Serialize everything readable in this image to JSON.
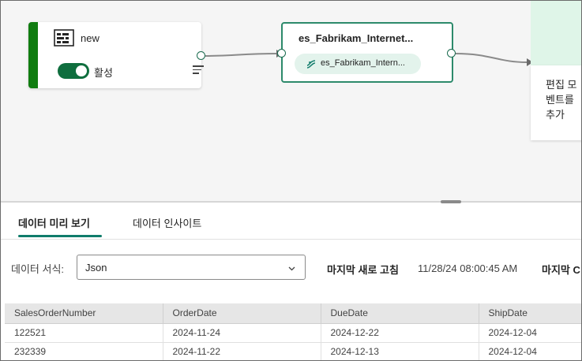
{
  "source_node": {
    "name": "new",
    "toggle_label": "활성",
    "toggle_on": true
  },
  "stream_node": {
    "title": "es_Fabrikam_Internet...",
    "pill_text": "es_Fabrikam_Intern..."
  },
  "destination_node": {
    "text": "편집 모\n벤트를\n추가"
  },
  "tabs": [
    {
      "label": "데이터 미리 보기",
      "active": true
    },
    {
      "label": "데이터 인사이트",
      "active": false
    }
  ],
  "toolbar": {
    "format_label": "데이터 서식:",
    "format_value": "Json",
    "last_refresh_label": "마지막 새로 고침",
    "last_refresh_value": "11/28/24 08:00:45 AM",
    "last_label_cut": "마지막 C"
  },
  "table": {
    "columns": [
      "SalesOrderNumber",
      "OrderDate",
      "DueDate",
      "ShipDate"
    ],
    "rows": [
      [
        "122521",
        "2024-11-24",
        "2024-12-22",
        "2024-12-04"
      ],
      [
        "232339",
        "2024-11-22",
        "2024-12-13",
        "2024-12-04"
      ]
    ]
  },
  "colors": {
    "accent": "#107c10",
    "stream_border": "#2d8a6b",
    "pill_bg": "#e3f3ec",
    "tab_underline": "#107c6b"
  }
}
